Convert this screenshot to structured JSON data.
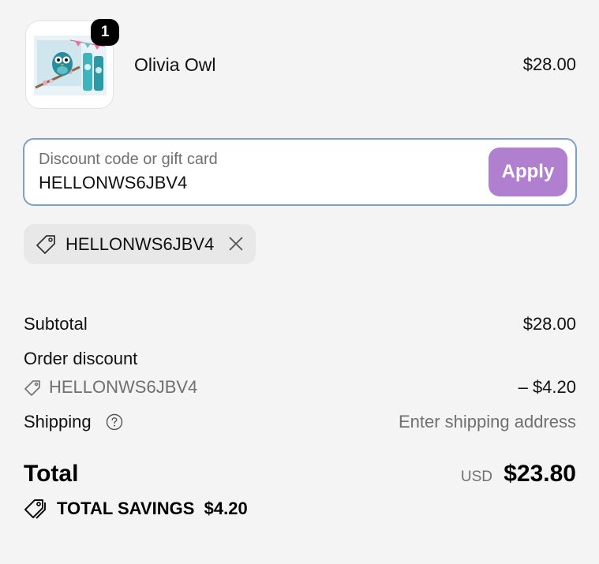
{
  "product": {
    "name": "Olivia Owl",
    "price": "$28.00",
    "quantity": "1",
    "image_icon": "owl-product-thumbnail"
  },
  "discount": {
    "label": "Discount code or gift card",
    "value": "HELLONWS6JBV4",
    "apply_label": "Apply"
  },
  "applied_code": {
    "code": "HELLONWS6JBV4",
    "tag_icon": "tag-icon",
    "remove_icon": "close-icon"
  },
  "summary": {
    "subtotal_label": "Subtotal",
    "subtotal_value": "$28.00",
    "order_discount_label": "Order discount",
    "discount_code": "HELLONWS6JBV4",
    "discount_value": "– $4.20",
    "shipping_label": "Shipping",
    "shipping_value": "Enter shipping address"
  },
  "total": {
    "label": "Total",
    "currency": "USD",
    "amount": "$23.80",
    "savings_label": "TOTAL SAVINGS",
    "savings_amount": "$4.20"
  },
  "colors": {
    "apply_button": "#b07fcf",
    "input_border": "#7c9fcd",
    "background": "#f4f4f4"
  }
}
